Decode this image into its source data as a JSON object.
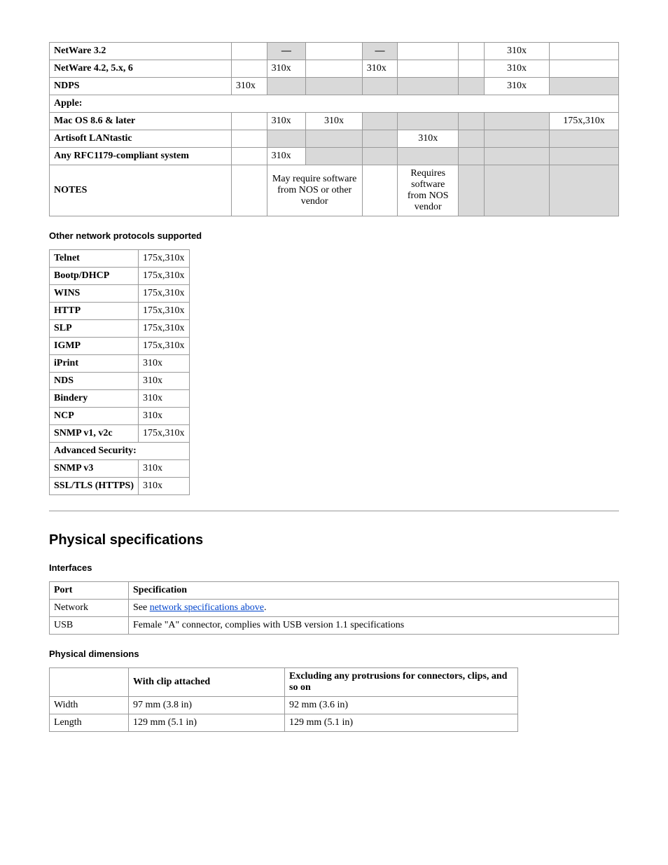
{
  "netTable": {
    "rows": [
      {
        "label": "NetWare 3.2",
        "c1": "",
        "c2": {
          "dash": true
        },
        "c3": "",
        "c4": {
          "dash": true
        },
        "c5": "",
        "c6": "",
        "c7": "310x",
        "c7center": true,
        "c8": ""
      },
      {
        "label": "NetWare 4.2, 5.x, 6",
        "c1": "",
        "c2": "310x",
        "c3": "",
        "c4": "310x",
        "c5": "",
        "c6": "",
        "c7": "310x",
        "c7center": true,
        "c8": ""
      },
      {
        "label": "NDPS",
        "c1": "310x",
        "c2": {
          "shaded": true
        },
        "c3": {
          "shaded": true
        },
        "c4": {
          "shaded": true
        },
        "c5": {
          "shaded": true
        },
        "c6": {
          "shaded": true
        },
        "c7": "310x",
        "c7center": true,
        "c8": {
          "shaded": true
        }
      },
      {
        "label": "Apple:",
        "spanAll": true
      },
      {
        "label": "Mac OS 8.6 & later",
        "c1": "",
        "c2": "310x",
        "c3": "310x",
        "c3center": true,
        "c4": {
          "shaded": true
        },
        "c5": {
          "shaded": true
        },
        "c6": {
          "shaded": true
        },
        "c7": {
          "shaded": true
        },
        "c8": "175x,310x",
        "c8center": true
      },
      {
        "label": "Artisoft LANtastic",
        "c1": "",
        "c2": {
          "shaded": true
        },
        "c3": {
          "shaded": true
        },
        "c4": {
          "shaded": true
        },
        "c5": "310x",
        "c5center": true,
        "c6": {
          "shaded": true
        },
        "c7": {
          "shaded": true
        },
        "c8": {
          "shaded": true
        }
      },
      {
        "label": "Any RFC1179-compliant system",
        "c1": "",
        "c2": "310x",
        "c3": {
          "shaded": true
        },
        "c4": {
          "shaded": true
        },
        "c5": {
          "shaded": true
        },
        "c6": {
          "shaded": true
        },
        "c7": {
          "shaded": true
        },
        "c8": {
          "shaded": true
        }
      },
      {
        "label": "NOTES",
        "c1": "",
        "note23": "May require software from NOS or other vendor",
        "c4": "",
        "note5": "Requires software from NOS vendor",
        "c6": {
          "shaded": true
        },
        "c7": {
          "shaded": true
        },
        "c8": {
          "shaded": true
        }
      }
    ]
  },
  "otherProtocolsHeading": "Other network protocols supported",
  "protocolsTable": [
    {
      "name": "Telnet",
      "val": "175x,310x"
    },
    {
      "name": "Bootp/DHCP",
      "val": "175x,310x"
    },
    {
      "name": "WINS",
      "val": "175x,310x"
    },
    {
      "name": "HTTP",
      "val": "175x,310x"
    },
    {
      "name": "SLP",
      "val": "175x,310x"
    },
    {
      "name": "IGMP",
      "val": "175x,310x"
    },
    {
      "name": "iPrint",
      "val": "310x"
    },
    {
      "name": "NDS",
      "val": "310x"
    },
    {
      "name": "Bindery",
      "val": "310x"
    },
    {
      "name": "NCP",
      "val": "310x"
    },
    {
      "name": "SNMP v1, v2c",
      "val": "175x,310x"
    },
    {
      "name": "Advanced Security:",
      "span": true
    },
    {
      "name": "SNMP v3",
      "val": "310x"
    },
    {
      "name": "SSL/TLS (HTTPS)",
      "val": "310x"
    }
  ],
  "physicalHeading": "Physical specifications",
  "interfacesHeading": "Interfaces",
  "interfacesTable": {
    "headers": [
      "Port",
      "Specification"
    ],
    "rows": [
      {
        "port": "Network",
        "specPrefix": "See ",
        "specLink": "network specifications above",
        "specSuffix": "."
      },
      {
        "port": "USB",
        "spec": "Female \"A\" connector, complies with USB version 1.1 specifications"
      }
    ]
  },
  "dimensionsHeading": "Physical dimensions",
  "dimensionsTable": {
    "headers": [
      "",
      "With clip attached",
      "Excluding any protrusions for connectors, clips, and so on"
    ],
    "rows": [
      {
        "label": "Width",
        "c1": "97 mm (3.8 in)",
        "c2": "92 mm (3.6 in)"
      },
      {
        "label": "Length",
        "c1": "129 mm (5.1 in)",
        "c2": "129 mm (5.1 in)"
      }
    ]
  }
}
